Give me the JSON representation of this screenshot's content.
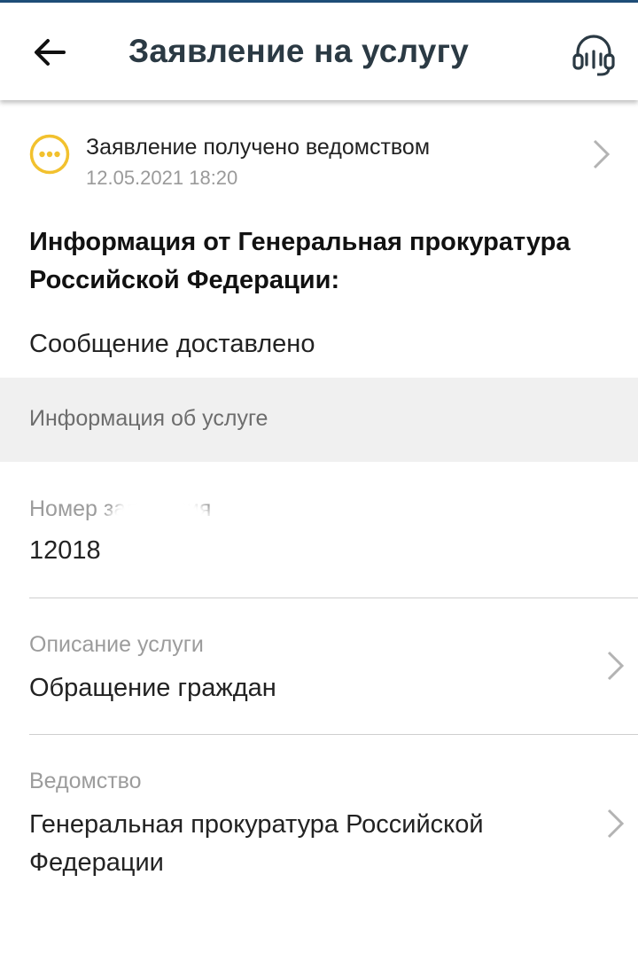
{
  "appbar": {
    "title": "Заявление на услугу",
    "back_icon": "arrow-left-icon",
    "support_icon": "headset-icon"
  },
  "status": {
    "title": "Заявление получено ведомством",
    "date": "12.05.2021 18:20",
    "icon": "more-dots-icon",
    "accent": "#f2c12e"
  },
  "info": {
    "heading": "Информация от Генеральная прокуратура Российской Федерации:",
    "message": "Сообщение доставлено"
  },
  "section": {
    "title": "Информация об услуге"
  },
  "fields": {
    "number": {
      "label": "Номер заявления",
      "value": "12018"
    },
    "description": {
      "label": "Описание услуги",
      "value": "Обращение граждан"
    },
    "agency": {
      "label": "Ведомство",
      "value": "Генеральная прокуратура Российской Федерации"
    }
  }
}
